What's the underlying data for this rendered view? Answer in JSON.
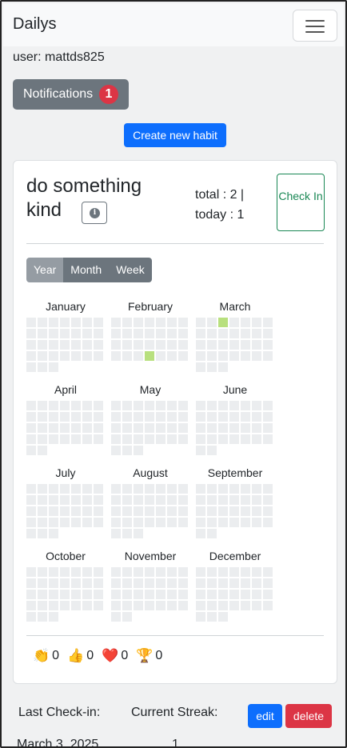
{
  "navbar": {
    "brand": "Dailys",
    "menu_icon": "hamburger-menu-icon"
  },
  "user_line": "user: mattds825",
  "notifications": {
    "label": "Notifications",
    "count": "1"
  },
  "create_button": "Create new habit",
  "habit": {
    "title": "do something kind",
    "info_icon": "info-circle-icon",
    "total_line": "total : 2 |",
    "today_line": "today : 1",
    "check_in_label": "Check In",
    "views": [
      {
        "label": "Year",
        "active": true
      },
      {
        "label": "Month",
        "active": false
      },
      {
        "label": "Week",
        "active": false
      }
    ],
    "months": [
      {
        "name": "January",
        "days": 31,
        "checked": []
      },
      {
        "name": "February",
        "days": 28,
        "checked": [
          25
        ]
      },
      {
        "name": "March",
        "days": 31,
        "checked": [
          3
        ]
      },
      {
        "name": "April",
        "days": 30,
        "checked": []
      },
      {
        "name": "May",
        "days": 31,
        "checked": []
      },
      {
        "name": "June",
        "days": 30,
        "checked": []
      },
      {
        "name": "July",
        "days": 31,
        "checked": []
      },
      {
        "name": "August",
        "days": 31,
        "checked": []
      },
      {
        "name": "September",
        "days": 30,
        "checked": []
      },
      {
        "name": "October",
        "days": 31,
        "checked": []
      },
      {
        "name": "November",
        "days": 30,
        "checked": []
      },
      {
        "name": "December",
        "days": 31,
        "checked": []
      }
    ],
    "reactions": [
      {
        "icon": "clapping-hands-icon",
        "glyph": "👏",
        "count": "0"
      },
      {
        "icon": "thumbs-up-icon",
        "glyph": "👍",
        "count": "0"
      },
      {
        "icon": "heart-icon",
        "glyph": "❤️",
        "count": "0"
      },
      {
        "icon": "trophy-icon",
        "glyph": "🏆",
        "count": "0"
      }
    ]
  },
  "footer": {
    "last_checkin_label": "Last Check-in:",
    "current_streak_label": "Current Streak:",
    "last_checkin_value": "March 3, 2025",
    "current_streak_value": "1",
    "edit_label": "edit",
    "delete_label": "delete"
  },
  "colors": {
    "primary": "#0d6efd",
    "secondary": "#6c757d",
    "danger": "#dc3545",
    "success": "#198754",
    "checked_cell": "#b8e07e"
  }
}
